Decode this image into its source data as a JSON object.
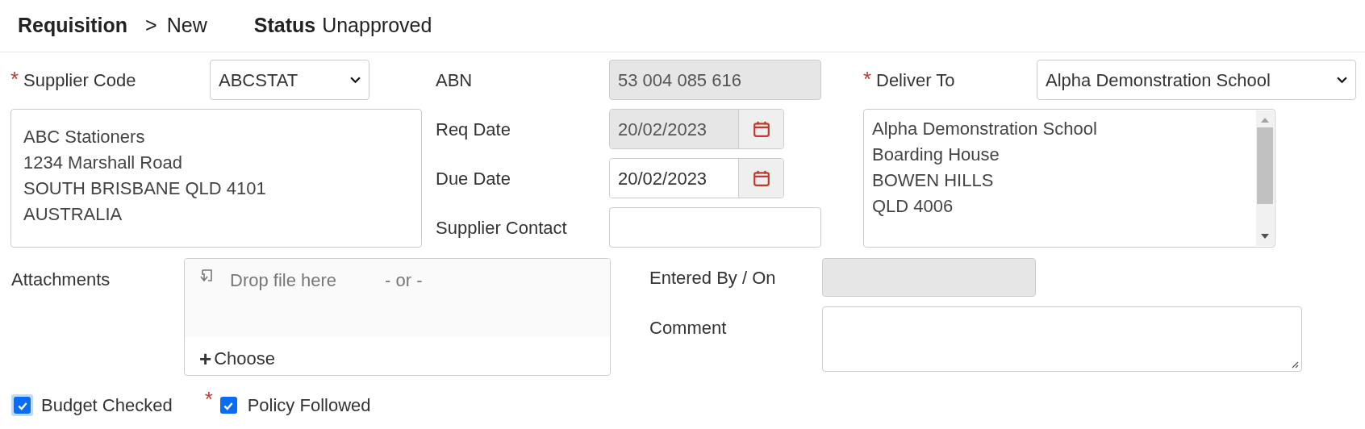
{
  "header": {
    "title": "Requisition",
    "separator": ">",
    "breadcrumb": "New",
    "status_label": "Status",
    "status_value": "Unapproved"
  },
  "supplier": {
    "required_mark": "*",
    "label": "Supplier Code",
    "value": "ABCSTAT",
    "address": [
      "ABC Stationers",
      "1234 Marshall Road",
      "SOUTH BRISBANE QLD 4101",
      "AUSTRALIA"
    ]
  },
  "fields": [
    {
      "kind": "text",
      "label": "ABN",
      "value": "53 004 085 616",
      "disabled": true
    },
    {
      "kind": "date",
      "label": "Req Date",
      "value": "20/02/2023",
      "disabled": true
    },
    {
      "kind": "date",
      "label": "Due Date",
      "value": "20/02/2023",
      "disabled": false
    },
    {
      "kind": "text",
      "label": "Supplier Contact",
      "disabled": false
    }
  ],
  "deliver_to": {
    "required_mark": "*",
    "label": "Deliver To",
    "value": "Alpha Demonstration School",
    "address": [
      "Alpha Demonstration School",
      "Boarding House",
      "BOWEN HILLS",
      "QLD 4006"
    ]
  },
  "attachments": {
    "label": "Attachments",
    "drop_text": "Drop file here",
    "or_text": "- or -",
    "choose_icon": "+",
    "choose_label": "Choose"
  },
  "entered_by": {
    "label": "Entered By / On",
    "disabled": true
  },
  "comment": {
    "label": "Comment"
  },
  "checkboxes": [
    {
      "label": "Budget Checked",
      "checked": true,
      "focused": true
    },
    {
      "required_mark": "*",
      "label": "Policy Followed",
      "checked": true,
      "focused": false
    }
  ]
}
